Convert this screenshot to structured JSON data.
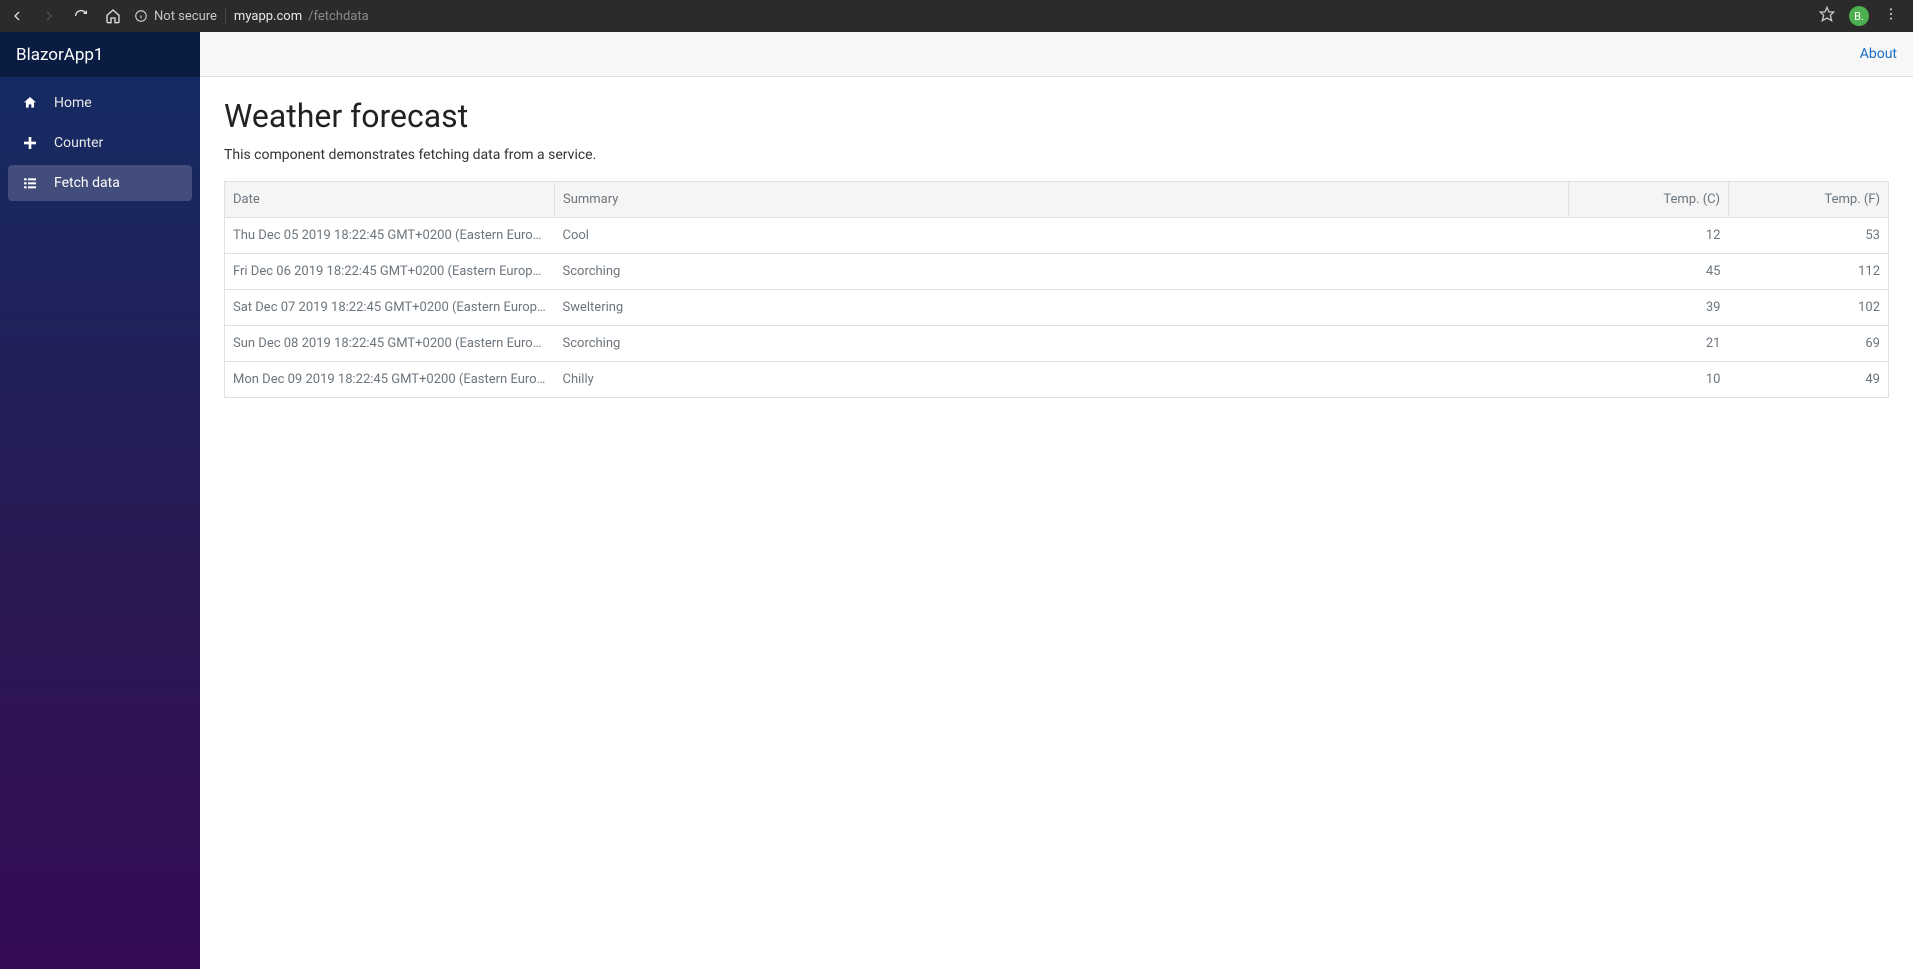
{
  "browser": {
    "security_label": "Not secure",
    "url_host": "myapp.com",
    "url_path": "/fetchdata",
    "avatar_initial": "B."
  },
  "sidebar": {
    "brand": "BlazorApp1",
    "items": [
      {
        "label": "Home",
        "icon": "home-icon",
        "active": false
      },
      {
        "label": "Counter",
        "icon": "plus-icon",
        "active": false
      },
      {
        "label": "Fetch data",
        "icon": "list-icon",
        "active": true
      }
    ]
  },
  "topbar": {
    "about_label": "About"
  },
  "page": {
    "title": "Weather forecast",
    "description": "This component demonstrates fetching data from a service."
  },
  "table": {
    "headers": {
      "date": "Date",
      "summary": "Summary",
      "tempC": "Temp. (C)",
      "tempF": "Temp. (F)"
    },
    "rows": [
      {
        "date": "Thu Dec 05 2019 18:22:45 GMT+0200 (Eastern European St...",
        "summary": "Cool",
        "tempC": "12",
        "tempF": "53"
      },
      {
        "date": "Fri Dec 06 2019 18:22:45 GMT+0200 (Eastern European Sta...",
        "summary": "Scorching",
        "tempC": "45",
        "tempF": "112"
      },
      {
        "date": "Sat Dec 07 2019 18:22:45 GMT+0200 (Eastern European St...",
        "summary": "Sweltering",
        "tempC": "39",
        "tempF": "102"
      },
      {
        "date": "Sun Dec 08 2019 18:22:45 GMT+0200 (Eastern European St...",
        "summary": "Scorching",
        "tempC": "21",
        "tempF": "69"
      },
      {
        "date": "Mon Dec 09 2019 18:22:45 GMT+0200 (Eastern European S...",
        "summary": "Chilly",
        "tempC": "10",
        "tempF": "49"
      }
    ]
  }
}
